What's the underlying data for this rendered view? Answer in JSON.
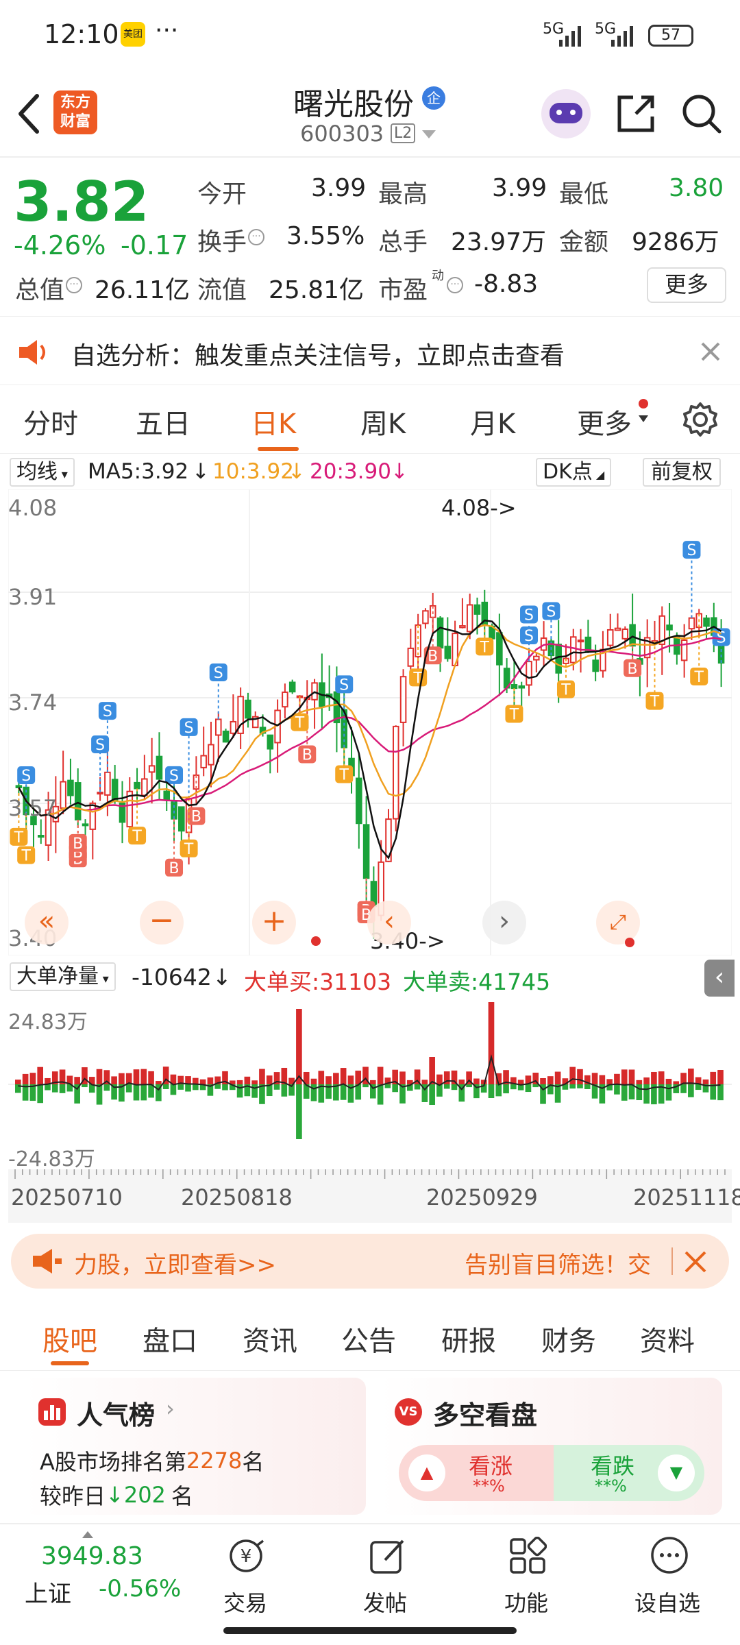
{
  "status": {
    "time": "12:10",
    "app_badge": "美团",
    "dots": "···",
    "net1": "5G",
    "net2": "5G",
    "battery": "57"
  },
  "header": {
    "logo_line1": "东方",
    "logo_line2": "财富",
    "title": "曙光股份",
    "title_badge": "企",
    "code": "600303",
    "level": "L2"
  },
  "quote": {
    "price": "3.82",
    "change_pct": "-4.26%",
    "change": "-0.17",
    "open_label": "今开",
    "open": "3.99",
    "high_label": "最高",
    "high": "3.99",
    "low_label": "最低",
    "low": "3.80",
    "turnover_label": "换手",
    "turnover": "3.55%",
    "volume_label": "总手",
    "volume": "23.97万",
    "amount_label": "金额",
    "amount": "9286万",
    "mcap_label": "总值",
    "mcap": "26.11亿",
    "float_label": "流值",
    "float": "25.81亿",
    "pe_label": "市盈",
    "pe_sup": "动",
    "pe": "-8.83",
    "more": "更多"
  },
  "notice": {
    "text": "自选分析：触发重点关注信号，立即点击查看"
  },
  "period_tabs": [
    "分时",
    "五日",
    "日K",
    "周K",
    "月K",
    "更多"
  ],
  "active_period": 2,
  "ma": {
    "selector": "均线",
    "ma5": "MA5:3.92",
    "ma10": "10:3.92",
    "ma20": "20:3.90",
    "dk": "DK点",
    "adjust": "前复权"
  },
  "kchart": {
    "y_top": "4.08",
    "y_2": "3.91",
    "y_3": "3.74",
    "y_4": "3.57",
    "y_bottom": "3.40",
    "hi_note": "4.08->",
    "lo_note": "3.40->"
  },
  "flow": {
    "selector": "大单净量",
    "net": "-10642",
    "buy": "大单买:31103",
    "sell": "大单卖:41745",
    "y_top": "24.83万",
    "y_bottom": "-24.83万"
  },
  "dates": [
    "20250710",
    "20250818",
    "20250929",
    "20251118"
  ],
  "banner": {
    "left": "力股，立即查看>>",
    "right": "告别盲目筛选！交"
  },
  "section_tabs": [
    "股吧",
    "盘口",
    "资讯",
    "公告",
    "研报",
    "财务",
    "资料"
  ],
  "cards": {
    "popularity_title": "人气榜",
    "rank_prefix": "A股市场排名第",
    "rank": "2278",
    "rank_suffix": "名",
    "change_prefix": "较昨日",
    "change_val": "202",
    "change_suffix": "名",
    "vs_title": "多空看盘",
    "bull": "看涨",
    "bull_val": "**%",
    "bear": "看跌",
    "bear_val": "**%"
  },
  "bottom": {
    "index_value": "3949.83",
    "index_name": "上证",
    "index_change": "-0.56%",
    "trade": "交易",
    "post": "发帖",
    "func": "功能",
    "watch": "设自选"
  }
}
